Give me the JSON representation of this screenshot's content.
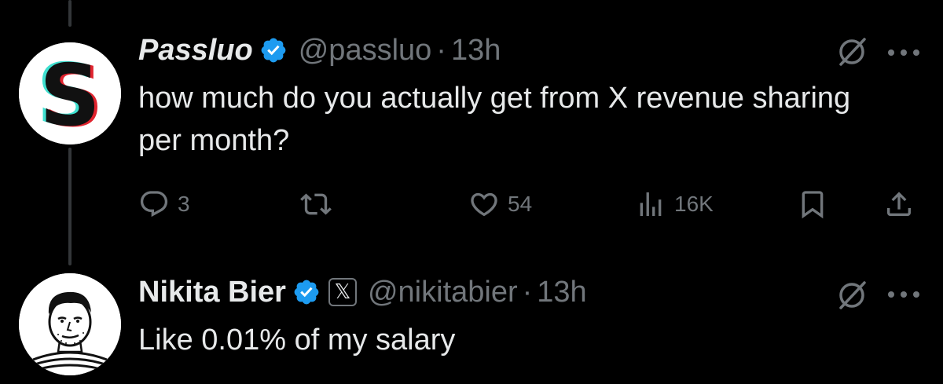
{
  "tweets": [
    {
      "name": "Passluo",
      "handle": "@passluo",
      "separator": "·",
      "time": "13h",
      "text": "how much do you actually get from X revenue sharing per month?",
      "avatar_letter": "S",
      "actions": {
        "replies": "3",
        "likes": "54",
        "views": "16K"
      }
    },
    {
      "name": "Nikita Bier",
      "affiliation_badge": "𝕏",
      "handle": "@nikitabier",
      "separator": "·",
      "time": "13h",
      "text": "Like 0.01% of my salary"
    }
  ],
  "colors": {
    "background": "#000000",
    "text": "#e7e9ea",
    "muted": "#71767b",
    "verified": "#1d9bf0"
  },
  "icons": [
    "verified-badge-icon",
    "grok-icon",
    "more-icon",
    "reply-icon",
    "retweet-icon",
    "like-icon",
    "views-icon",
    "bookmark-icon",
    "share-icon",
    "x-affiliation-icon"
  ]
}
